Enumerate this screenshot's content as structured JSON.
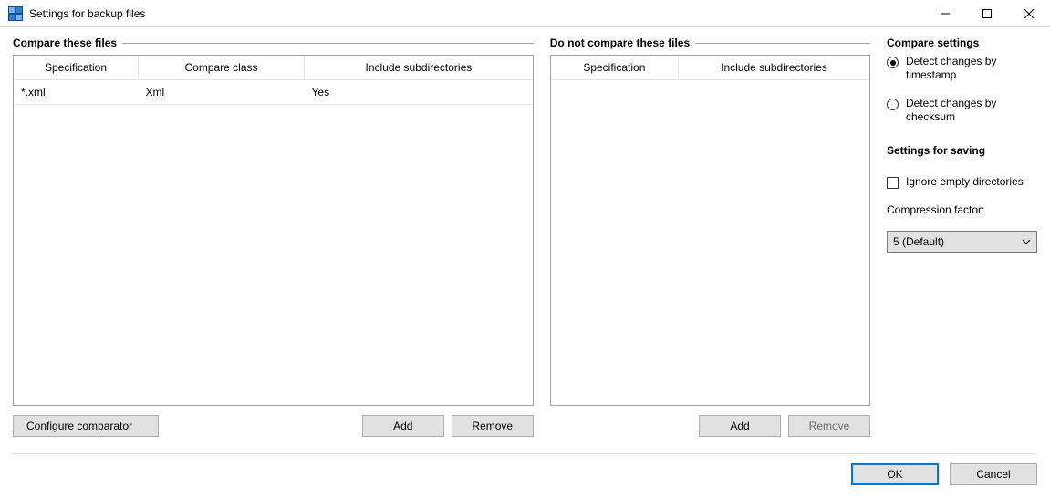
{
  "window": {
    "title": "Settings for backup files"
  },
  "left": {
    "caption": "Compare these files",
    "columns": [
      "Specification",
      "Compare class",
      "Include subdirectories"
    ],
    "rows": [
      {
        "spec": "*.xml",
        "klass": "Xml",
        "incl": "Yes"
      }
    ],
    "buttons": {
      "configure": "Configure comparator",
      "add": "Add",
      "remove": "Remove"
    }
  },
  "mid": {
    "caption": "Do not compare these files",
    "columns": [
      "Specification",
      "Include subdirectories"
    ],
    "rows": [],
    "buttons": {
      "add": "Add",
      "remove": "Remove"
    }
  },
  "right": {
    "caption": "Compare settings",
    "radios": {
      "timestamp": "Detect changes by timestamp",
      "checksum": "Detect changes by checksum"
    },
    "selected_radio": "timestamp",
    "save_caption": "Settings for saving",
    "ignore_empty": {
      "label": "Ignore empty directories",
      "checked": false
    },
    "compression_label": "Compression factor:",
    "compression_value": "5 (Default)"
  },
  "footer": {
    "ok": "OK",
    "cancel": "Cancel"
  }
}
